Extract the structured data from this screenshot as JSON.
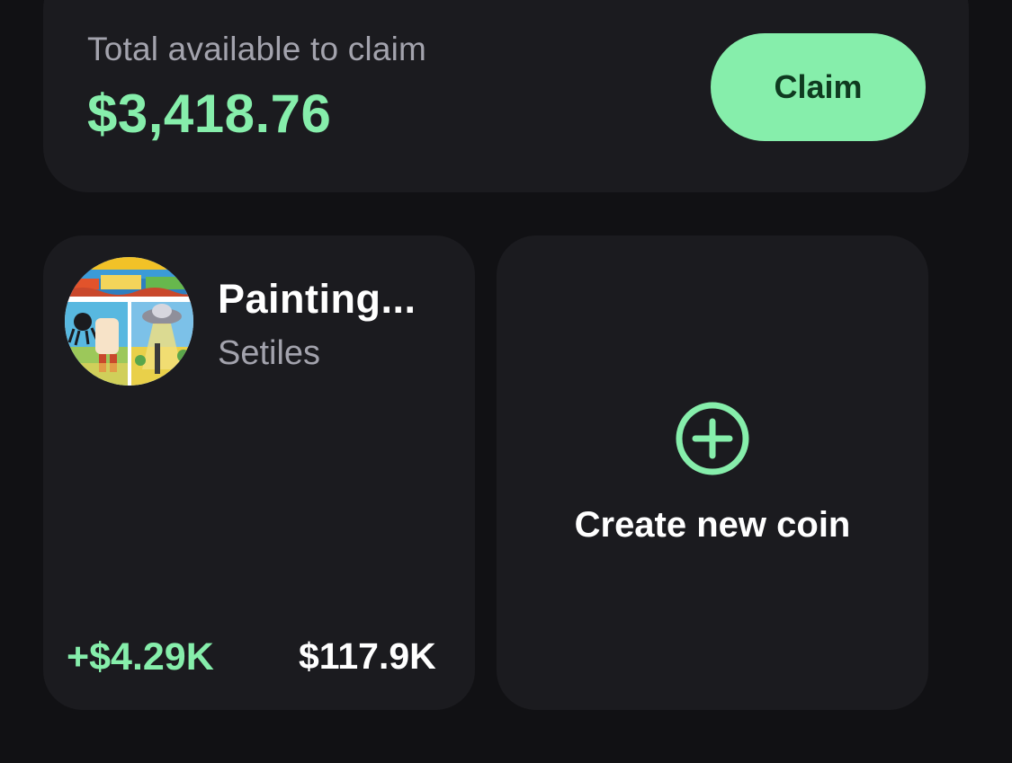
{
  "claim": {
    "label": "Total available to claim",
    "amount": "$3,418.76",
    "button_label": "Claim"
  },
  "coins": [
    {
      "name": "Painting...",
      "creator": "Setiles",
      "change": "+$4.29K",
      "market_cap": "$117.9K",
      "avatar_icon": "painting-collage-thumbnail"
    }
  ],
  "create": {
    "label": "Create new coin",
    "icon": "plus-circle-icon"
  },
  "colors": {
    "background": "#111114",
    "card": "#1b1b1f",
    "accent": "#86eeab",
    "muted_text": "#a3a3ad",
    "text": "#ffffff"
  }
}
